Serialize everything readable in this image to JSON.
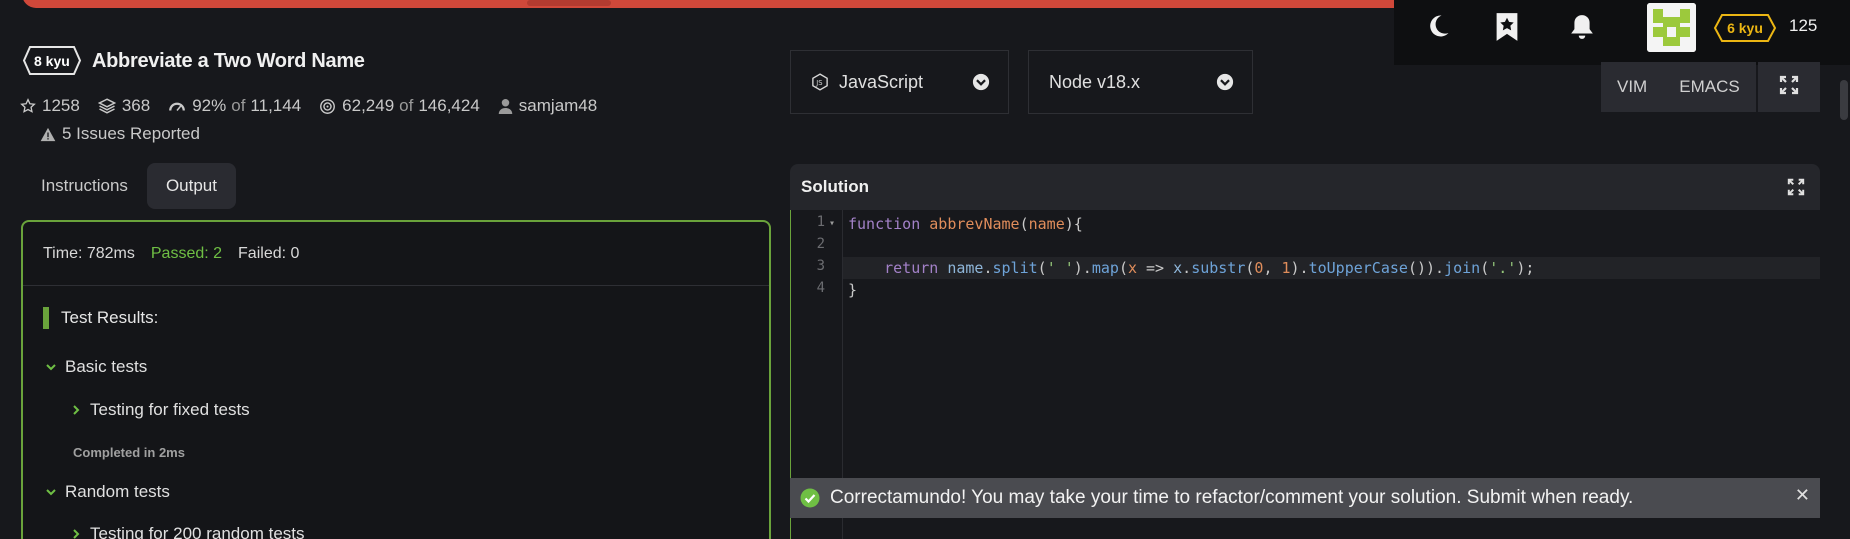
{
  "header": {
    "kyu": "8 kyu",
    "title": "Abbreviate a Two Word Name",
    "stats": {
      "stars": "1258",
      "collections": "368",
      "satisfaction_pct": "92%",
      "satisfaction_of_word": "of",
      "satisfaction_total": "11,144",
      "completed": "62,249",
      "completed_of_word": "of",
      "attempts": "146,424",
      "author": "samjam48"
    },
    "issues": "5 Issues Reported"
  },
  "tabs": [
    {
      "label": "Instructions",
      "active": false
    },
    {
      "label": "Output",
      "active": true
    }
  ],
  "output": {
    "time": "Time: 782ms",
    "passed": "Passed: 2",
    "failed": "Failed: 0",
    "results_heading": "Test Results:",
    "groups": [
      {
        "label": "Basic tests",
        "child": "Testing for fixed tests",
        "completed": "Completed in 2ms"
      },
      {
        "label": "Random tests",
        "child": "Testing for 200 random tests"
      }
    ]
  },
  "language_select": {
    "value": "JavaScript"
  },
  "version_select": {
    "value": "Node v18.x"
  },
  "topbar": {
    "rank": "6 kyu",
    "honor": "125",
    "icons": [
      "moon-icon",
      "bookmark-star-icon",
      "bell-icon"
    ]
  },
  "editor_modes": [
    "VIM",
    "EMACS"
  ],
  "solution": {
    "title": "Solution",
    "line_numbers": [
      "1",
      "2",
      "3",
      "4"
    ],
    "code": {
      "l1_fn": "function",
      "l1_name": "abbrevName",
      "l1_param": "name",
      "l3_return": "return",
      "l3_var": "name",
      "l3_split": "split",
      "l3_space": "' '",
      "l3_map": "map",
      "l3_x": "x",
      "l3_arrow": "=>",
      "l3_x2": "x",
      "l3_substr": "substr",
      "l3_zero": "0",
      "l3_one": "1",
      "l3_upper": "toUpperCase",
      "l3_join": "join",
      "l3_dot": "'.'",
      "l4": "}"
    }
  },
  "success_banner": "Correctamundo! You may take your time to refactor/comment your solution. Submit when ready.",
  "colors": {
    "accent_green": "#6aa33b",
    "banner_red": "#d0483a",
    "rank_yellow": "#ecb613"
  }
}
